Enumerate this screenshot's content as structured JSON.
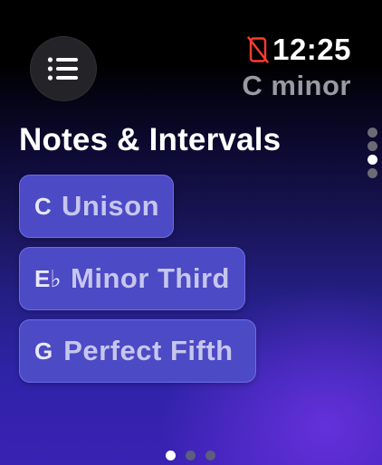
{
  "status": {
    "time": "12:25",
    "key": "C minor",
    "icons": [
      "phone-disconnected-icon"
    ],
    "alert_color": "#ff3b30"
  },
  "menu": {
    "icon": "list-icon"
  },
  "page": {
    "title": "Notes & Intervals"
  },
  "intervals": [
    {
      "note": "C",
      "name": "Unison"
    },
    {
      "note": "E♭",
      "name": "Minor Third"
    },
    {
      "note": "G",
      "name": "Perfect Fifth"
    }
  ],
  "scroll_indicator": {
    "count": 4,
    "active_index": 2
  },
  "page_indicator": {
    "count": 3,
    "active_index": 0
  },
  "colors": {
    "button_fill": "#4c4ac4",
    "button_border": "#6d6cec",
    "background_top": "#000000",
    "background_bottom": "#3a22b4"
  }
}
